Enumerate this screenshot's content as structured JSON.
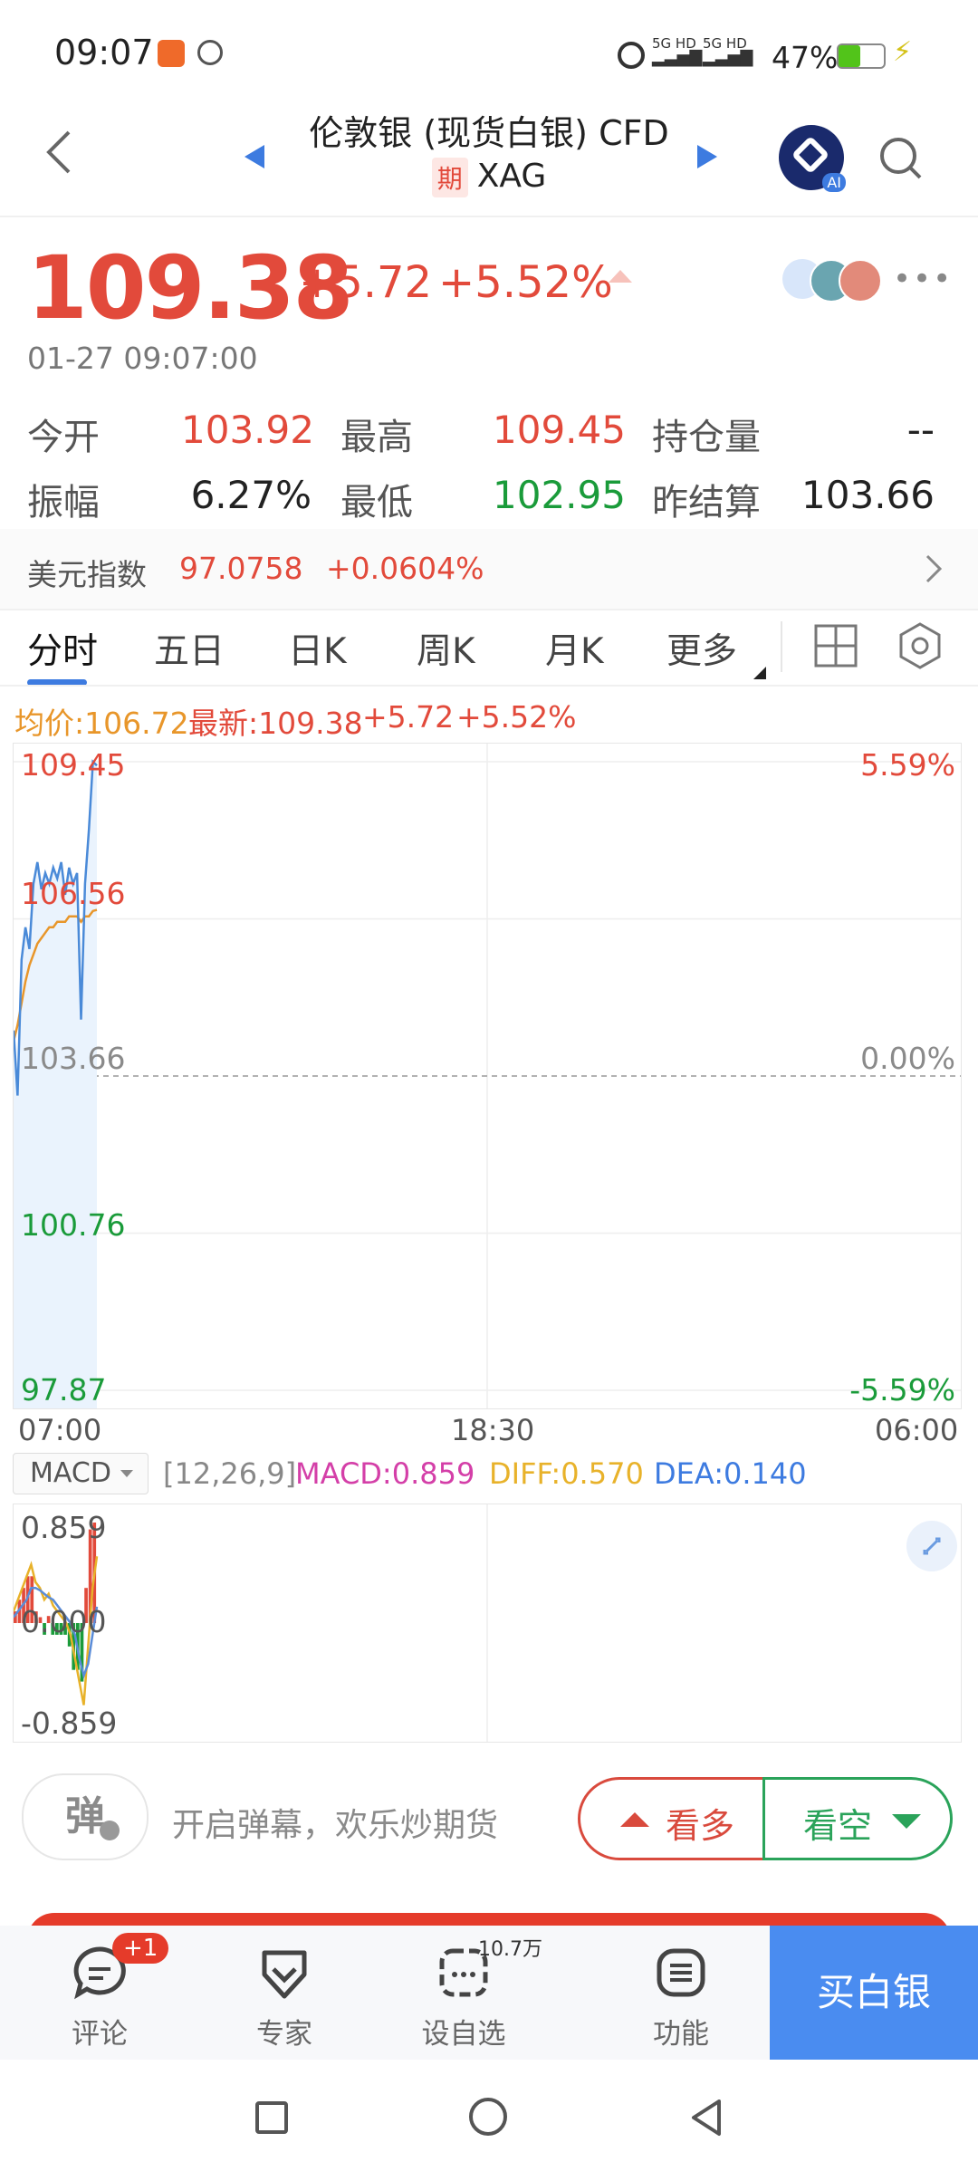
{
  "status_bar": {
    "time": "09:07",
    "battery_pct": "47%",
    "net1": "5G HD",
    "net2": "5G HD"
  },
  "header": {
    "title": "伦敦银 (现货白银) CFD",
    "tag": "期",
    "symbol": "XAG",
    "ai_badge": "AI"
  },
  "quote": {
    "price": "109.38",
    "change": "+5.72",
    "change_pct": "+5.52%",
    "datetime": "01-27 09:07:00"
  },
  "stats": {
    "open_label": "今开",
    "open": "103.92",
    "high_label": "最高",
    "high": "109.45",
    "oi_label": "持仓量",
    "oi": "--",
    "amp_label": "振幅",
    "amp": "6.27%",
    "low_label": "最低",
    "low": "102.95",
    "prev_label": "昨结算",
    "prev": "103.66"
  },
  "usd_index": {
    "label": "美元指数",
    "value": "97.0758",
    "change": "+0.0604%"
  },
  "tabs": [
    "分时",
    "五日",
    "日K",
    "周K",
    "月K",
    "更多"
  ],
  "legend": {
    "avg": "均价:106.72",
    "latest": "最新:109.38",
    "chg": "+5.72",
    "pct": "+5.52%"
  },
  "chart_data": [
    {
      "type": "line",
      "title": "",
      "y_left_ticks": [
        "109.45",
        "106.56",
        "103.66",
        "100.76",
        "97.87"
      ],
      "y_right_ticks": [
        "5.59%",
        "",
        "0.00%",
        "",
        "-5.59%"
      ],
      "x_ticks": [
        "07:00",
        "18:30",
        "06:00"
      ],
      "ylim": [
        97.87,
        109.45
      ],
      "baseline": 103.66,
      "series": [
        {
          "name": "",
          "color": "#4a8ad8",
          "values": [
            104.5,
            103.3,
            105.8,
            106.4,
            106.0,
            107.2,
            107.6,
            107.1,
            107.4,
            107.2,
            107.5,
            107.3,
            107.6,
            107.0,
            107.5,
            107.2,
            107.4,
            104.7,
            107.2,
            108.2,
            109.45,
            109.38
          ]
        },
        {
          "name": "均价",
          "color": "#e8962a",
          "values": [
            104.3,
            104.6,
            105.0,
            105.4,
            105.7,
            105.9,
            106.1,
            106.2,
            106.3,
            106.4,
            106.4,
            106.5,
            106.5,
            106.5,
            106.6,
            106.6,
            106.6,
            106.5,
            106.6,
            106.6,
            106.7,
            106.72
          ]
        }
      ]
    },
    {
      "type": "line",
      "title": "MACD",
      "params": "[12,26,9]",
      "macd_label": "MACD:0.859",
      "diff_label": "DIFF:0.570",
      "dea_label": "DEA:0.140",
      "y_ticks": [
        "0.859",
        "0.000",
        "-0.859"
      ],
      "ylim": [
        -0.859,
        0.859
      ],
      "series": [
        {
          "name": "DIFF",
          "color": "#e8b22a",
          "values": [
            0.1,
            0.2,
            0.3,
            0.4,
            0.5,
            0.35,
            0.3,
            0.2,
            0.25,
            0.15,
            0.1,
            0.05,
            0.0,
            -0.1,
            -0.3,
            -0.5,
            -0.7,
            -0.2,
            0.3,
            0.57
          ]
        },
        {
          "name": "DEA",
          "color": "#5a8cd8",
          "values": [
            0.05,
            0.1,
            0.15,
            0.2,
            0.3,
            0.3,
            0.28,
            0.25,
            0.22,
            0.2,
            0.15,
            0.1,
            0.05,
            0.0,
            -0.1,
            -0.3,
            -0.45,
            -0.35,
            -0.1,
            0.14
          ]
        },
        {
          "name": "MACD",
          "color": "#e24a3b",
          "values": [
            0.1,
            0.2,
            0.3,
            0.4,
            0.4,
            0.1,
            0.05,
            -0.1,
            0.06,
            -0.1,
            -0.1,
            -0.1,
            -0.1,
            -0.2,
            -0.4,
            -0.4,
            -0.5,
            0.3,
            0.8,
            0.859
          ]
        }
      ]
    }
  ],
  "danmu": {
    "button": "弹",
    "prompt": "开启弹幕，欢乐炒期货"
  },
  "trade": {
    "bull": "看多",
    "bear": "看空"
  },
  "bottom_nav": {
    "comment": "评论",
    "comment_badge": "+1",
    "expert": "专家",
    "watch": "设自选",
    "watch_count": "10.7万",
    "functions": "功能",
    "buy": "买白银"
  },
  "colors": {
    "up": "#e24a3b",
    "down": "#1a9b3a",
    "accent": "#4a8cf0"
  }
}
